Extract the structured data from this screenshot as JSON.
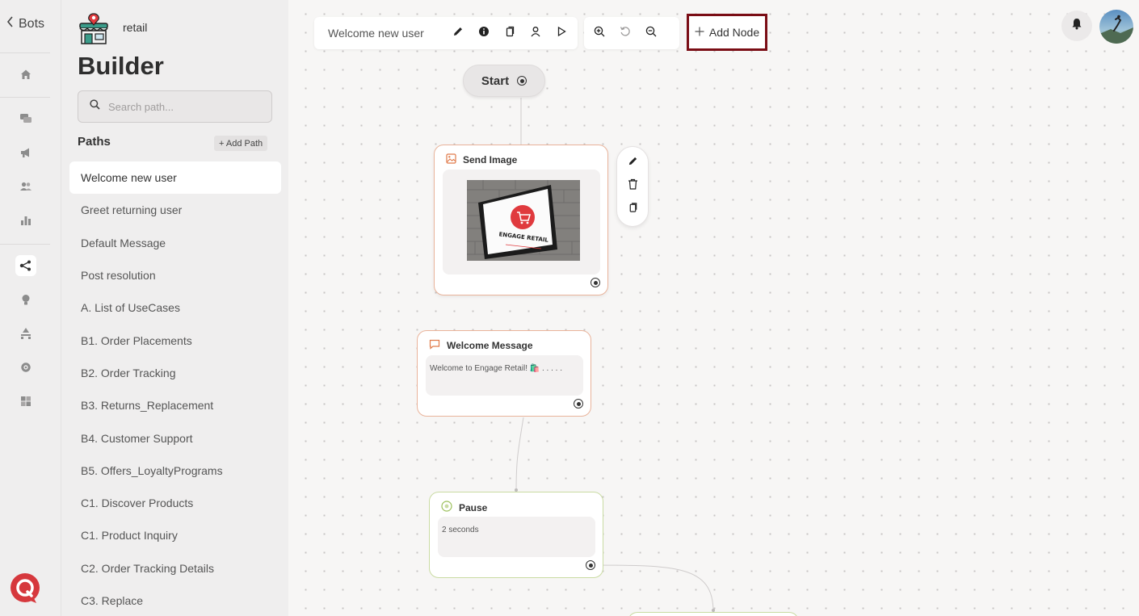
{
  "rail": {
    "back_label": "Bots",
    "icons": [
      "home-icon",
      "chat-icon",
      "megaphone-icon",
      "users-icon",
      "bar-chart-icon",
      "flow-icon",
      "bulb-icon",
      "hierarchy-icon",
      "gear-icon",
      "integrations-icon"
    ]
  },
  "panel": {
    "org_name": "retail",
    "title": "Builder",
    "search_placeholder": "Search path...",
    "paths_label": "Paths",
    "add_path_label": "+ Add Path",
    "paths": [
      "Welcome new user",
      "Greet returning user",
      "Default Message",
      "Post resolution",
      "A. List of UseCases",
      "B1. Order Placements",
      "B2. Order Tracking",
      "B3. Returns_Replacement",
      "B4. Customer Support",
      "B5. Offers_LoyaltyPrograms",
      "C1. Discover Products",
      "C1. Product Inquiry",
      "C2. Order Tracking Details",
      "C3. Replace"
    ],
    "active_path": "Welcome new user"
  },
  "toolbar": {
    "current_path": "Welcome new user",
    "add_node_label": "Add Node"
  },
  "canvas": {
    "start_label": "Start",
    "nodes": {
      "send_image": {
        "title": "Send Image",
        "image_text": "ENGAGE RETAIL"
      },
      "welcome": {
        "title": "Welcome Message",
        "text": "Welcome to Engage Retail! 🛍️ . . . . ."
      },
      "pause": {
        "title": "Pause",
        "text": "2 seconds"
      }
    }
  },
  "colors": {
    "accent_border": "#7a0d15",
    "message_node_border": "#e9b39a",
    "pause_node_border": "#c9dba2",
    "brand_red": "#e03a3e"
  }
}
